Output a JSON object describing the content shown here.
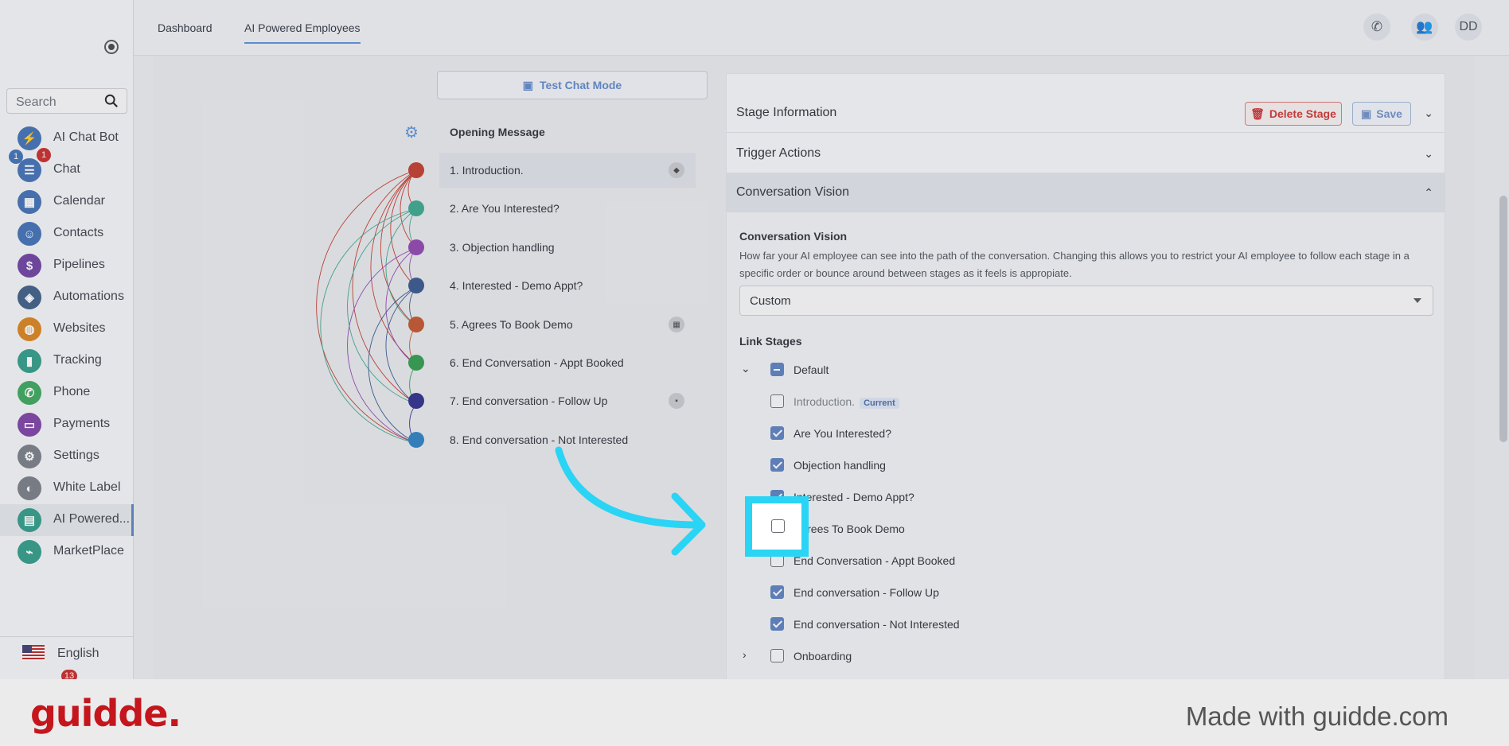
{
  "sidebar": {
    "search_placeholder": "Search",
    "items": [
      {
        "label": "AI Chat Bot",
        "icon": "lightning-icon",
        "color": "#3f6fb3"
      },
      {
        "label": "Chat",
        "icon": "chat-icon",
        "color": "#3f6fb3"
      },
      {
        "label": "Calendar",
        "icon": "calendar-icon",
        "color": "#3f6fb3"
      },
      {
        "label": "Contacts",
        "icon": "contacts-icon",
        "color": "#3f6fb3"
      },
      {
        "label": "Pipelines",
        "icon": "dollar-icon",
        "color": "#6b3fa0"
      },
      {
        "label": "Automations",
        "icon": "automation-icon",
        "color": "#3d5c85"
      },
      {
        "label": "Websites",
        "icon": "globe-icon",
        "color": "#d8821c"
      },
      {
        "label": "Tracking",
        "icon": "chart-icon",
        "color": "#2e9a86"
      },
      {
        "label": "Phone",
        "icon": "phone-icon",
        "color": "#3aa55a"
      },
      {
        "label": "Payments",
        "icon": "card-icon",
        "color": "#7a3fa3"
      },
      {
        "label": "Settings",
        "icon": "gear-icon",
        "color": "#777c85"
      },
      {
        "label": "White Label",
        "icon": "palette-icon",
        "color": "#777c85"
      },
      {
        "label": "AI Powered...",
        "icon": "robot-chat-icon",
        "color": "#2e9a86"
      },
      {
        "label": "MarketPlace",
        "icon": "plug-icon",
        "color": "#2e9a86"
      }
    ],
    "chat_badge_left": "1",
    "chat_badge_right": "1",
    "bottom_badge": "13",
    "language": "English"
  },
  "topbar": {
    "tabs": [
      "Dashboard",
      "AI Powered Employees"
    ],
    "avatar": "DD"
  },
  "flow": {
    "test_chat": "Test Chat Mode",
    "opening": "Opening Message",
    "stages": [
      {
        "label": "1. Introduction.",
        "color": "#c0392b",
        "icon": "tag-icon"
      },
      {
        "label": "2. Are You Interested?",
        "color": "#3aa58a",
        "icon": ""
      },
      {
        "label": "3. Objection handling",
        "color": "#8e44ad",
        "icon": ""
      },
      {
        "label": "4. Interested - Demo Appt?",
        "color": "#34558b",
        "icon": ""
      },
      {
        "label": "5. Agrees To Book Demo",
        "color": "#c0532b",
        "icon": "calendar-icon"
      },
      {
        "label": "6. End Conversation - Appt Booked",
        "color": "#2e9a4a",
        "icon": ""
      },
      {
        "label": "7. End conversation - Follow Up",
        "color": "#2c2c8b",
        "icon": "message-icon"
      },
      {
        "label": "8. End conversation - Not Interested",
        "color": "#2a7fc1",
        "icon": ""
      }
    ]
  },
  "panel": {
    "stage_info": "Stage Information",
    "delete_label": "Delete Stage",
    "save_label": "Save",
    "trigger_actions": "Trigger Actions",
    "conversation_vision": "Conversation Vision",
    "cv_label": "Conversation Vision",
    "cv_desc": "How far your AI employee can see into the path of the conversation. Changing this allows you to restrict your AI employee to follow each stage in a specific order or bounce around between stages as it feels is appropiate.",
    "cv_value": "Custom",
    "link_stages": "Link Stages",
    "group_default": "Default",
    "current_tag": "Current",
    "links": [
      {
        "label": "Introduction.",
        "checked": false
      },
      {
        "label": "Are You Interested?",
        "checked": true
      },
      {
        "label": "Objection handling",
        "checked": true
      },
      {
        "label": "Interested - Demo Appt?",
        "checked": true
      },
      {
        "label": "Agrees To Book Demo",
        "checked": false
      },
      {
        "label": "End Conversation - Appt Booked",
        "checked": false
      },
      {
        "label": "End conversation - Follow Up",
        "checked": true
      },
      {
        "label": "End conversation - Not Interested",
        "checked": true
      }
    ],
    "group_onboarding": "Onboarding"
  },
  "footer": {
    "logo": "guidde.",
    "made_with": "Made with guidde.com"
  }
}
